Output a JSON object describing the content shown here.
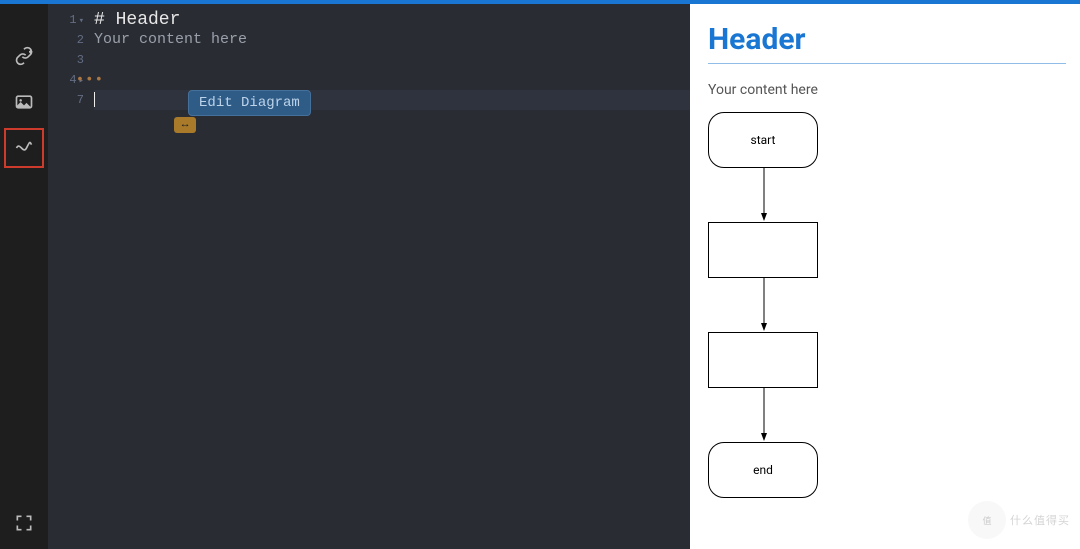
{
  "editor": {
    "gutter_lines": [
      "1",
      "2",
      "3",
      "4",
      "7"
    ],
    "line1": "# Header",
    "line2": "Your content here",
    "edit_diagram_label": "Edit Diagram",
    "arrow_glyph": "↔"
  },
  "preview": {
    "header": "Header",
    "body": "Your content here"
  },
  "diagram": {
    "start_label": "start",
    "end_label": "end"
  },
  "watermark": {
    "brand": "什么值得买"
  }
}
